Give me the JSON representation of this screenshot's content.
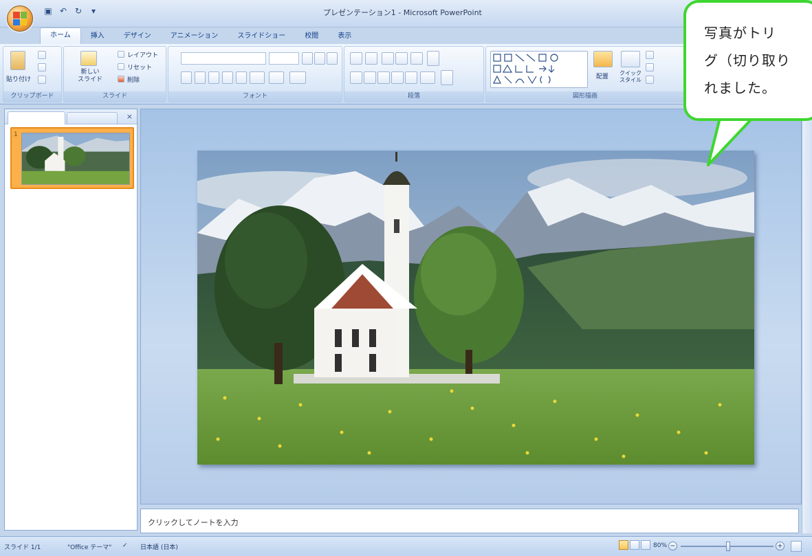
{
  "window": {
    "title": "プレゼンテーション1 - Microsoft PowerPoint"
  },
  "ribbon": {
    "tabs": [
      {
        "label": "ホーム",
        "active": true
      },
      {
        "label": "挿入",
        "active": false
      },
      {
        "label": "デザイン",
        "active": false
      },
      {
        "label": "アニメーション",
        "active": false
      },
      {
        "label": "スライドショー",
        "active": false
      },
      {
        "label": "校閲",
        "active": false
      },
      {
        "label": "表示",
        "active": false
      }
    ],
    "clipboard": {
      "paste_label": "貼り付け",
      "group_label": "クリップボード"
    },
    "slides": {
      "new_slide_label": "新しい\nスライド",
      "layout_label": "レイアウト",
      "reset_label": "リセット",
      "delete_label": "削除",
      "group_label": "スライド"
    },
    "font": {
      "group_label": "フォント"
    },
    "paragraph": {
      "group_label": "段落"
    },
    "drawing": {
      "arrange_label": "配置",
      "quick_styles_label": "クイック\nスタイル",
      "group_label": "図形描画"
    }
  },
  "slides_panel": {
    "slide_number": "1"
  },
  "notes": {
    "placeholder": "クリックしてノートを入力"
  },
  "status": {
    "slide": "スライド 1/1",
    "theme": "\"Office テーマ\"",
    "language": "日本語 (日本)",
    "zoom": "80%"
  },
  "callout": {
    "text": "写真がトリ\nグ（切り取り\nれました。"
  },
  "colors": {
    "callout_border": "#3ed630",
    "selected_thumb": "#fbb04a"
  }
}
